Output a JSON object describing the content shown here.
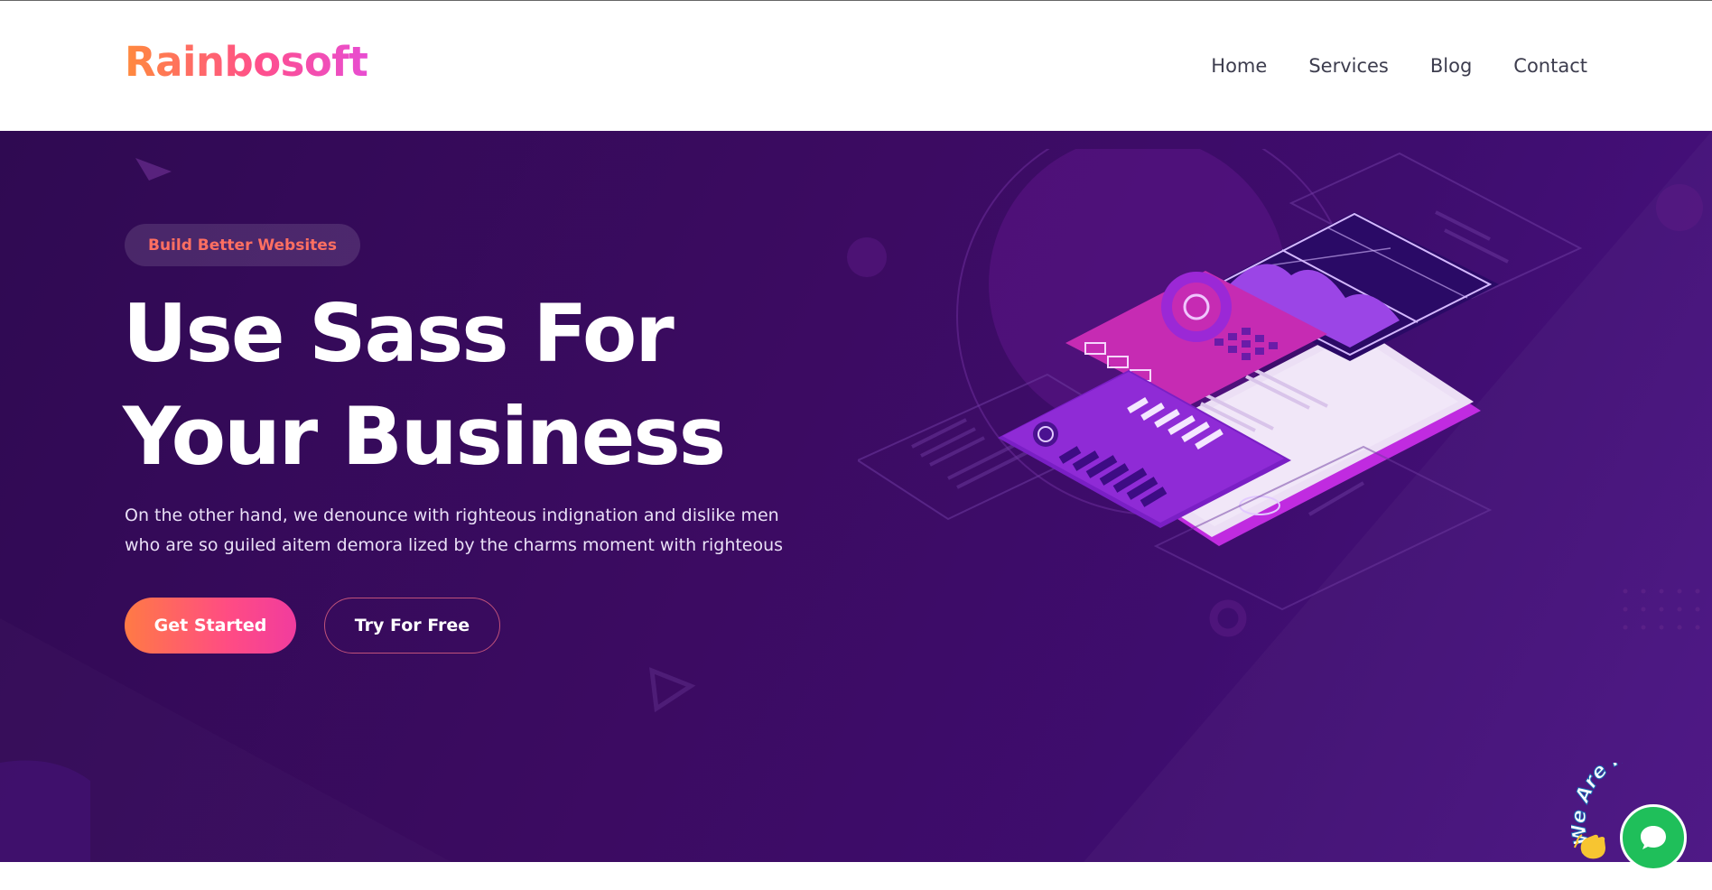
{
  "header": {
    "logo": "Rainbosoft",
    "nav": [
      "Home",
      "Services",
      "Blog",
      "Contact"
    ]
  },
  "hero": {
    "badge": "Build Better Websites",
    "headline_line1": "Use Sass For",
    "headline_line2": "Your Business",
    "description_line1": "On the other hand, we denounce with righteous indignation and dislike men",
    "description_line2": "who are so guiled aitem demora lized by the charms moment with righteous",
    "primary_button": "Get Started",
    "secondary_button": "Try For Free"
  },
  "chat_widget": {
    "banner": "We Are Here!"
  },
  "colors": {
    "hero_background": "#3c0b62",
    "brand_gradient_start": "#ff8a3d",
    "brand_gradient_end": "#e84dd2",
    "badge_text": "#ff6f61",
    "chat_green": "#1fbf5a"
  },
  "icons": {
    "chat": "chat-bubble-icon",
    "wave": "waving-hand-icon"
  }
}
